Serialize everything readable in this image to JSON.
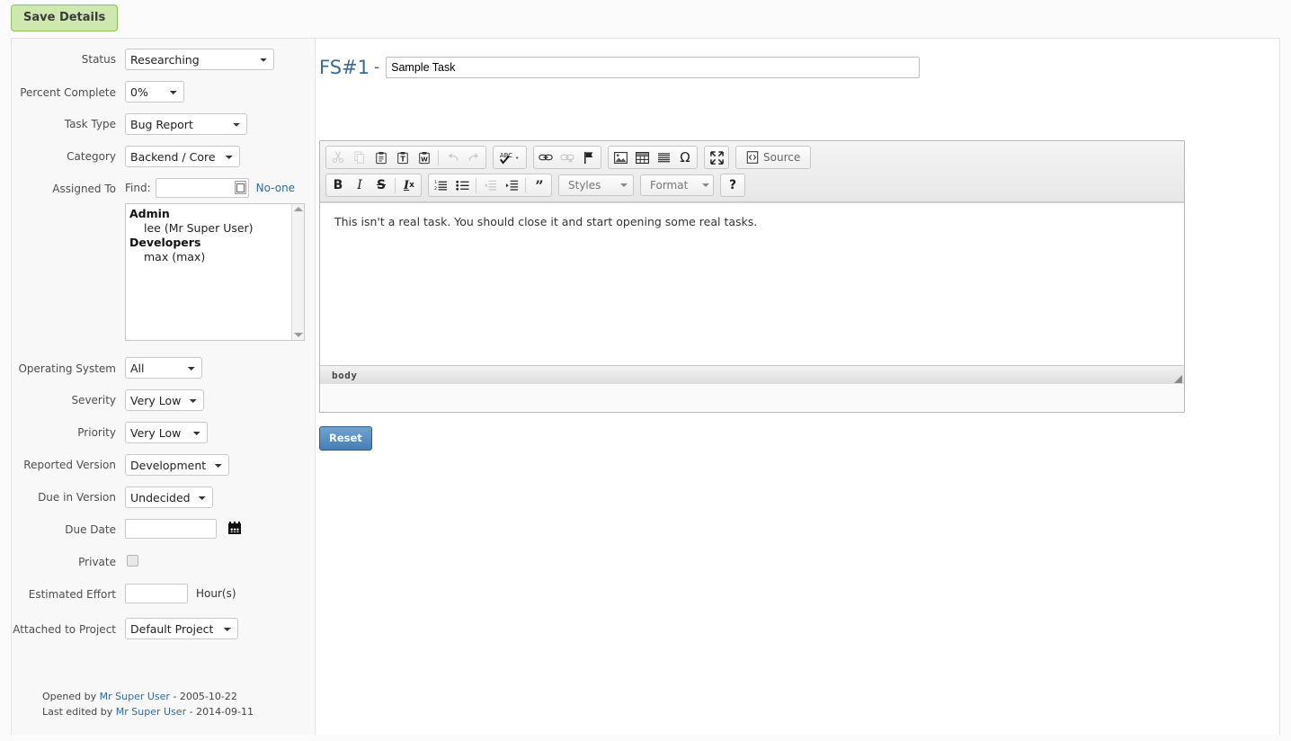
{
  "toolbar": {
    "save_label": "Save Details"
  },
  "sidebar": {
    "fields": {
      "status": {
        "label": "Status",
        "value": "Researching"
      },
      "percent_complete": {
        "label": "Percent Complete",
        "value": "0%"
      },
      "task_type": {
        "label": "Task Type",
        "value": "Bug Report"
      },
      "category": {
        "label": "Category",
        "value": "Backend / Core"
      },
      "assigned_to": {
        "label": "Assigned To",
        "find_label": "Find:",
        "find_value": "",
        "noone_label": "No-one",
        "groups": [
          {
            "name": "Admin",
            "members": [
              "lee (Mr Super User)"
            ]
          },
          {
            "name": "Developers",
            "members": [
              "max (max)"
            ]
          }
        ]
      },
      "operating_system": {
        "label": "Operating System",
        "value": "All"
      },
      "severity": {
        "label": "Severity",
        "value": "Very Low"
      },
      "priority": {
        "label": "Priority",
        "value": "Very Low"
      },
      "reported_version": {
        "label": "Reported Version",
        "value": "Development"
      },
      "due_in_version": {
        "label": "Due in Version",
        "value": "Undecided"
      },
      "due_date": {
        "label": "Due Date",
        "value": ""
      },
      "private": {
        "label": "Private",
        "checked": false
      },
      "estimated_effort": {
        "label": "Estimated Effort",
        "value": "",
        "unit": "Hour(s)"
      },
      "attached_to_project": {
        "label": "Attached to Project",
        "value": "Default Project"
      }
    },
    "meta": {
      "opened_prefix": "Opened by",
      "opened_user": "Mr Super User",
      "opened_sep": "-",
      "opened_date": "2005-10-22",
      "edited_prefix": "Last edited by",
      "edited_user": "Mr Super User",
      "edited_sep": "-",
      "edited_date": "2014-09-11"
    }
  },
  "main": {
    "task_id": "FS#1",
    "task_id_dash": "-",
    "task_title": "Sample Task",
    "task_title_placeholder": "",
    "editor": {
      "row1": [
        {
          "name": "cut-icon",
          "title": "Cut",
          "disabled": true
        },
        {
          "name": "copy-icon",
          "title": "Copy",
          "disabled": true
        },
        {
          "name": "paste-icon",
          "title": "Paste",
          "disabled": false
        },
        {
          "name": "paste-text-icon",
          "title": "Paste as plain text",
          "disabled": false
        },
        {
          "name": "paste-word-icon",
          "title": "Paste from Word",
          "disabled": false
        },
        {
          "name": "undo-icon",
          "title": "Undo",
          "disabled": true
        },
        {
          "name": "redo-icon",
          "title": "Redo",
          "disabled": true
        },
        {
          "name": "spellcheck-icon",
          "title": "Check Spelling",
          "disabled": false
        },
        {
          "name": "link-icon",
          "title": "Link",
          "disabled": false
        },
        {
          "name": "unlink-icon",
          "title": "Unlink",
          "disabled": true
        },
        {
          "name": "anchor-flag-icon",
          "title": "Anchor",
          "disabled": false
        },
        {
          "name": "image-icon",
          "title": "Image",
          "disabled": false
        },
        {
          "name": "table-icon",
          "title": "Table",
          "disabled": false
        },
        {
          "name": "horizontal-rule-icon",
          "title": "Horizontal Line",
          "disabled": false
        },
        {
          "name": "special-character-icon",
          "title": "Special Character",
          "disabled": false
        },
        {
          "name": "maximize-icon",
          "title": "Maximize",
          "disabled": false
        }
      ],
      "source_label": "Source",
      "bold_label": "B",
      "italic_label": "I",
      "strike_label": "S",
      "removeformat_label": "I",
      "removeformat_sub": "x",
      "quote_label": "”",
      "styles_label": "Styles",
      "format_label": "Format",
      "help_label": "?",
      "content": "This isn't a real task. You should close it and start opening some real tasks.",
      "element_path": "body"
    },
    "reset_label": "Reset"
  }
}
